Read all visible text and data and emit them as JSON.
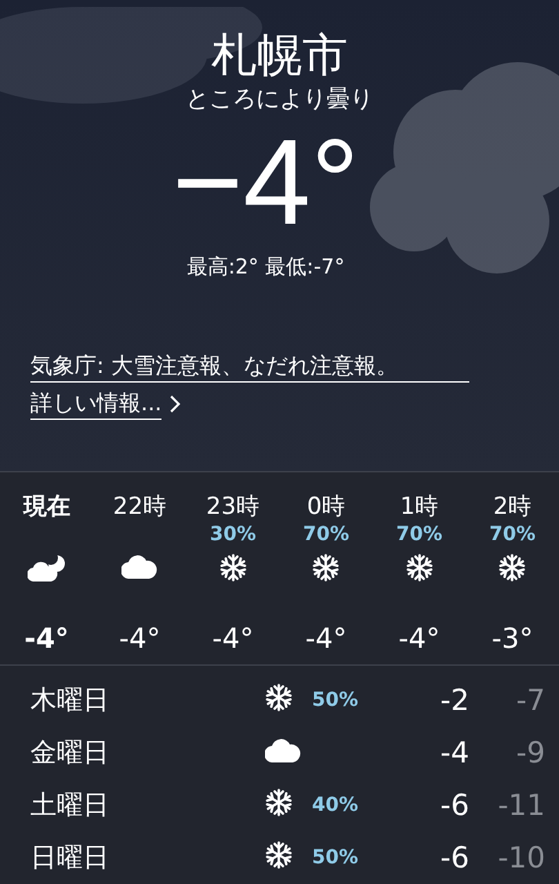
{
  "location": {
    "city": "札幌市",
    "condition": "ところにより曇り",
    "temperature": "−4°",
    "high_low": "最高:2° 最低:-7°"
  },
  "alert": {
    "text": "気象庁: 大雪注意報、なだれ注意報。",
    "link": "詳しい情報..."
  },
  "hourly": [
    {
      "time": "現在",
      "selected": true,
      "kind": "moon-cloud",
      "temp": "-4°"
    },
    {
      "time": "22時",
      "selected": false,
      "kind": "cloud",
      "temp": "-4°"
    },
    {
      "time": "23時",
      "selected": false,
      "precip": "30%",
      "kind": "snow",
      "temp": "-4°"
    },
    {
      "time": "0時",
      "selected": false,
      "precip": "70%",
      "kind": "snow",
      "temp": "-4°"
    },
    {
      "time": "1時",
      "selected": false,
      "precip": "70%",
      "kind": "snow",
      "temp": "-4°"
    },
    {
      "time": "2時",
      "selected": false,
      "precip": "70%",
      "kind": "snow",
      "temp": "-3°"
    }
  ],
  "daily": [
    {
      "day": "木曜日",
      "kind": "snow",
      "precip": "50%",
      "high": "-2",
      "low": "-7"
    },
    {
      "day": "金曜日",
      "kind": "cloud",
      "high": "-4",
      "low": "-9"
    },
    {
      "day": "土曜日",
      "kind": "snow",
      "precip": "40%",
      "high": "-6",
      "low": "-11"
    },
    {
      "day": "日曜日",
      "kind": "snow",
      "precip": "50%",
      "high": "-6",
      "low": "-10"
    }
  ]
}
